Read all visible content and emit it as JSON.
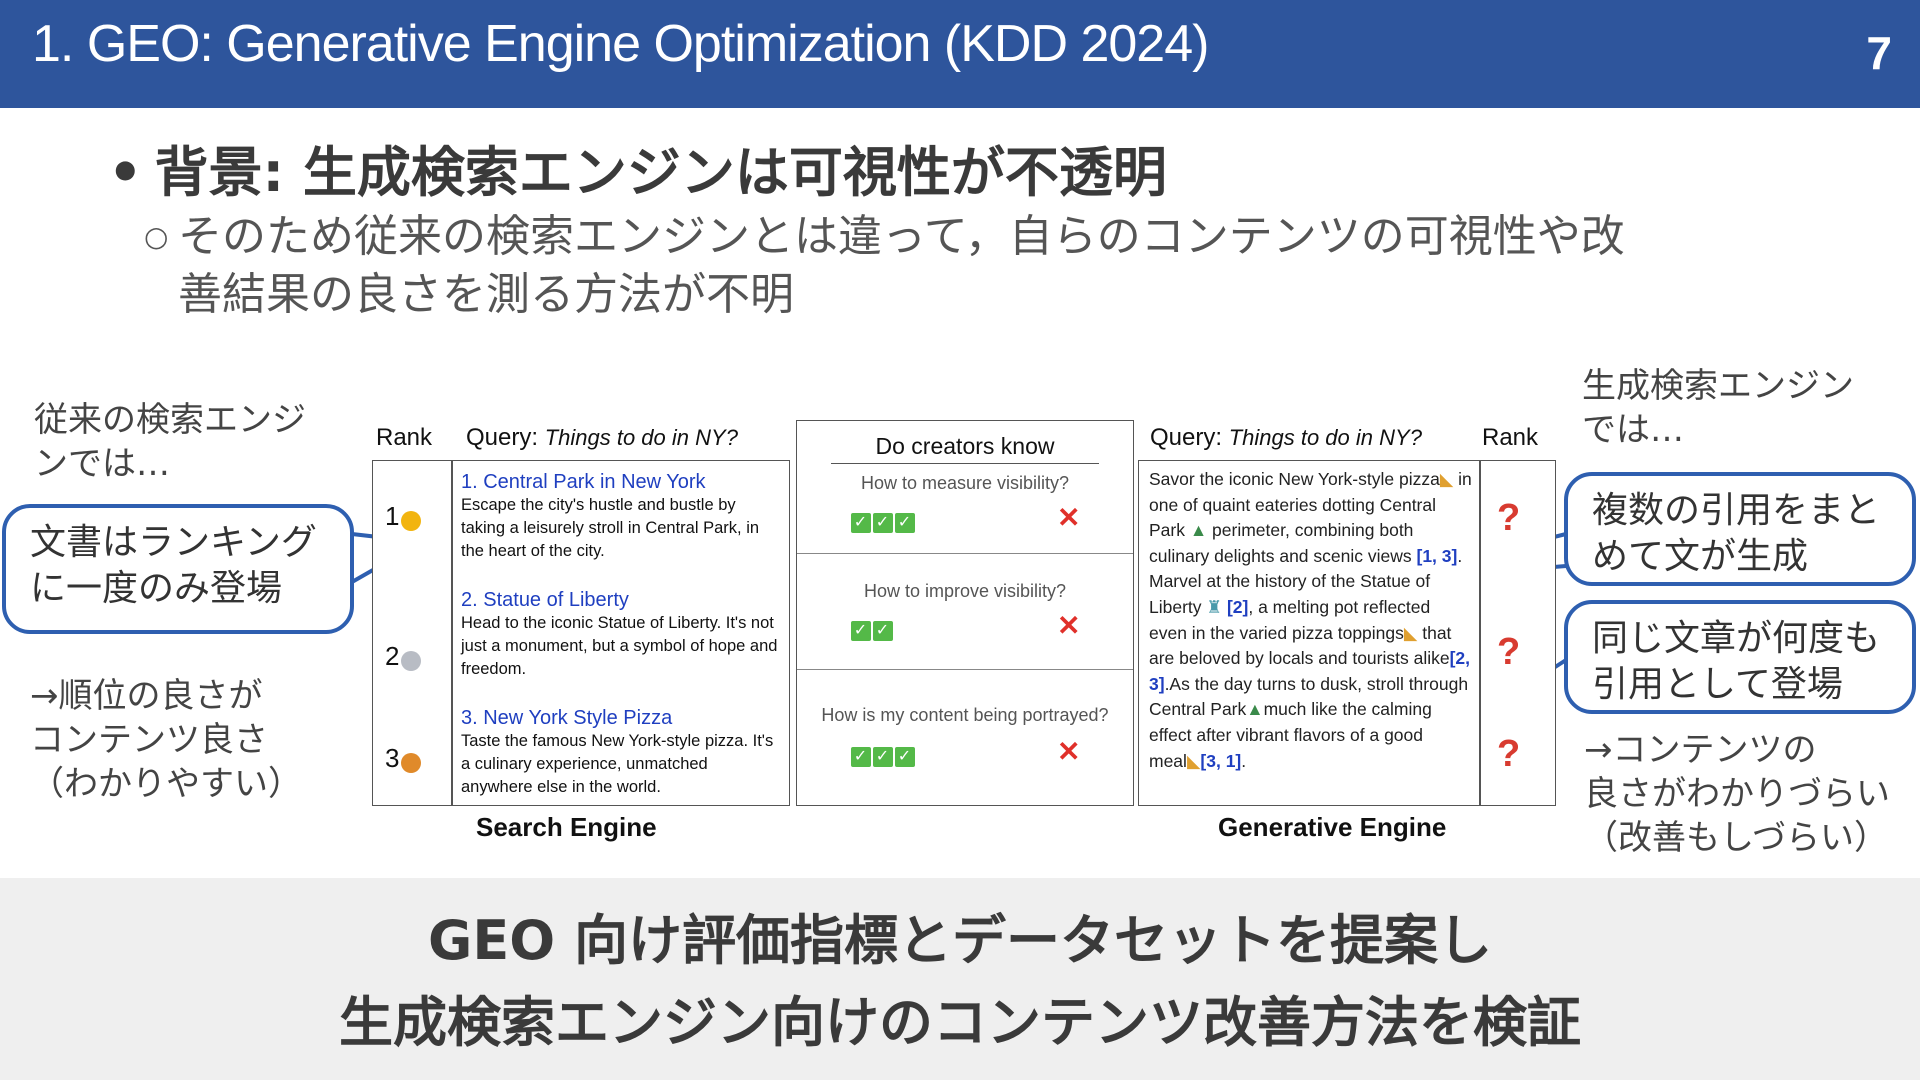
{
  "header": {
    "title": "1. GEO: Generative Engine Optimization (KDD 2024)",
    "page_number": "7"
  },
  "bullets": {
    "main": "背景: 生成検索エンジンは可視性が不透明",
    "sub_line1": "そのため従来の検索エンジンとは違って，自らのコンテンツの可視性や改",
    "sub_line2": "善結果の良さを測る方法が不明"
  },
  "notes": {
    "left_title": [
      "従来の検索エンジ",
      "ンでは…"
    ],
    "left_conclusion": [
      "→順位の良さが",
      "コンテンツ良さ",
      "（わかりやすい）"
    ],
    "right_title": [
      "生成検索エンジン",
      "では…"
    ],
    "right_conclusion": [
      "→コンテンツの",
      "良さがわかりづらい",
      "（改善もしづらい）"
    ]
  },
  "callouts": {
    "left": [
      "文書はランキング",
      "に一度のみ登場"
    ],
    "right1": [
      "複数の引用をまと",
      "めて文が生成"
    ],
    "right2": [
      "同じ文章が何度も",
      "引用として登場"
    ]
  },
  "figure": {
    "search": {
      "rank_label": "Rank",
      "query_label": "Query:",
      "query_text": "Things to do in NY?",
      "results": [
        {
          "rank": "1",
          "title": "1. Central Park in New York",
          "snippet": "Escape the city's hustle and bustle by taking a leisurely stroll in Central Park, in the heart of the city."
        },
        {
          "rank": "2",
          "title": "2. Statue of Liberty",
          "snippet": "Head to the iconic Statue of Liberty. It's not just a monument, but a symbol of hope and freedom."
        },
        {
          "rank": "3",
          "title": "3. New York Style Pizza",
          "snippet": "Taste the famous New York-style pizza. It's a culinary experience, unmatched anywhere else in the world."
        }
      ],
      "label": "Search Engine"
    },
    "middle": {
      "title": "Do creators know",
      "questions": [
        "How to measure visibility?",
        "How to improve visibility?",
        "How is my content being portrayed?"
      ],
      "check_counts": [
        3,
        2,
        3
      ]
    },
    "generative": {
      "query_label": "Query:",
      "query_text": "Things to do in NY?",
      "rank_label": "Rank",
      "text_parts": [
        "Savor the iconic New York-style pizza",
        " in one of quaint eateries dotting Central Park ",
        " perimeter, combining both culinary delights and scenic views ",
        "[1, 3]",
        ". Marvel at the history of the Statue of Liberty ",
        "[2]",
        ", a melting pot reflected even in the varied pizza toppings",
        " that are beloved by locals and tourists alike",
        "[2, 3]",
        ".As the day turns to dusk, stroll through Central Park",
        "much like the calming effect after vibrant flavors of a good meal",
        "[3, 1]",
        "."
      ],
      "rank_marks": [
        "?",
        "?",
        "?"
      ],
      "label": "Generative Engine"
    }
  },
  "footer": {
    "line1": "GEO 向け評価指標とデータセットを提案し",
    "line2": "生成検索エンジン向けのコンテンツ改善方法を検証"
  },
  "colors": {
    "header_bg": "#2e559c",
    "callout_border": "#2e5fb0",
    "link_blue": "#1f3fc0",
    "cross_red": "#e0302a",
    "check_green": "#54b948",
    "footer_bg": "#efefef"
  }
}
